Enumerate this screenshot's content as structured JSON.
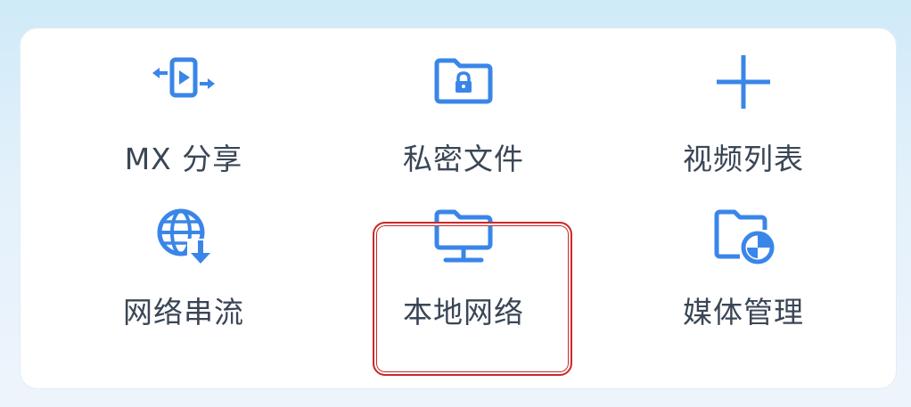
{
  "accent_color": "#3a86e8",
  "label_color": "#3a4656",
  "highlight_color": "#c92a2a",
  "tiles": [
    {
      "label": "MX 分享",
      "icon": "share-transfer-icon"
    },
    {
      "label": "私密文件",
      "icon": "locked-folder-icon"
    },
    {
      "label": "视频列表",
      "icon": "plus-icon"
    },
    {
      "label": "网络串流",
      "icon": "globe-download-icon"
    },
    {
      "label": "本地网络",
      "icon": "folder-network-icon"
    },
    {
      "label": "媒体管理",
      "icon": "folder-pie-chart-icon"
    }
  ],
  "selected_tile": "本地网络"
}
